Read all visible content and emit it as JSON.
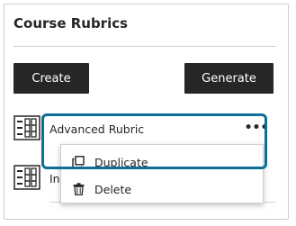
{
  "panel": {
    "title": "Course Rubrics"
  },
  "actions": {
    "create_label": "Create",
    "generate_label": "Generate"
  },
  "rubrics": [
    {
      "label": "Advanced Rubric",
      "icon": "rubric-grid-icon"
    },
    {
      "label": "In",
      "icon": "rubric-grid-icon"
    }
  ],
  "context_menu": {
    "trigger": "more-options-icon",
    "items": [
      {
        "label": "Duplicate",
        "icon": "duplicate-icon"
      },
      {
        "label": "Delete",
        "icon": "trash-icon"
      }
    ]
  },
  "colors": {
    "button_bg": "#262626",
    "highlight": "#0e6e94",
    "border": "#cdcdcd"
  }
}
